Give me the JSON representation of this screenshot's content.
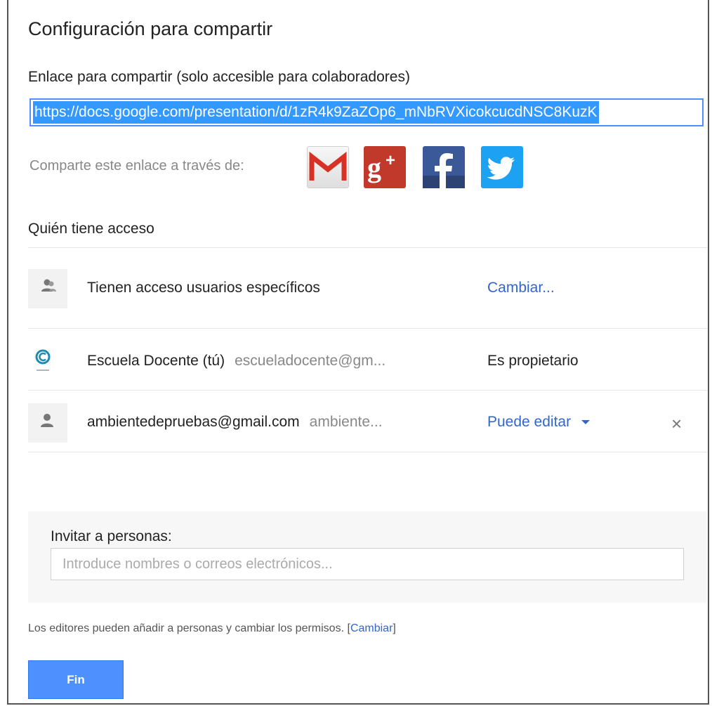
{
  "dialog": {
    "title": "Configuración para compartir"
  },
  "link": {
    "label": "Enlace para compartir (solo accesible para colaboradores)",
    "url": "https://docs.google.com/presentation/d/1zR4k9ZaZOp6_mNbRVXicokcucdNSC8KuzK"
  },
  "share_via": {
    "label": "Comparte este enlace a través de:",
    "services": [
      "gmail-icon",
      "google-plus-icon",
      "facebook-icon",
      "twitter-icon"
    ],
    "colors": {
      "gmail": "#d93025",
      "google_plus": "#c0392b",
      "facebook": "#3b5998",
      "twitter": "#1da1f2"
    }
  },
  "access": {
    "heading": "Quién tiene acceso",
    "visibility": {
      "text": "Tienen acceso usuarios específicos",
      "action": "Cambiar..."
    },
    "people": [
      {
        "name": "Escuela Docente (tú)",
        "email": "escueladocente@gm...",
        "role": "Es propietario"
      },
      {
        "name": "ambientedepruebas@gmail.com",
        "email": "ambiente...",
        "role": "Puede editar"
      }
    ],
    "remove_symbol": "×"
  },
  "invite": {
    "label": "Invitar a personas:",
    "placeholder": "Introduce nombres o correos electrónicos...",
    "value": ""
  },
  "footer": {
    "note": "Los editores pueden añadir a personas y cambiar los permisos.",
    "change_link": "Cambiar",
    "done_button": "Fin"
  },
  "accent_color": "#4d90fe",
  "link_color": "#3366cc"
}
